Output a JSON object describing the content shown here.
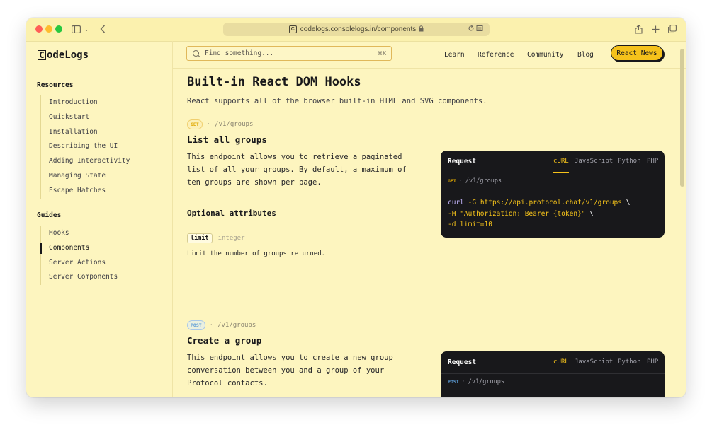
{
  "browser": {
    "url": "codelogs.consolelogs.in/components",
    "site_icon": "C",
    "colors": {
      "close": "#ff5f57",
      "minimize": "#febc2e",
      "maximize": "#28c840"
    }
  },
  "brand": {
    "logo_mark": "C",
    "logo_text": "odeLogs"
  },
  "sidebar": {
    "sections": [
      {
        "heading": "Resources",
        "items": [
          "Introduction",
          "Quickstart",
          "Installation",
          "Describing the UI",
          "Adding Interactivity",
          "Managing State",
          "Escape Hatches"
        ]
      },
      {
        "heading": "Guides",
        "items": [
          "Hooks",
          "Components",
          "Server Actions",
          "Server Components"
        ],
        "active": "Components"
      }
    ]
  },
  "topnav": {
    "search_placeholder": "Find something...",
    "search_shortcut": "⌘K",
    "links": [
      "Learn",
      "Reference",
      "Community",
      "Blog"
    ],
    "cta": "React News"
  },
  "page": {
    "title": "Built-in React DOM Hooks",
    "lead": "React supports all of the browser built-in HTML and SVG components."
  },
  "endpoints": [
    {
      "method": "GET",
      "path": "/v1/groups",
      "title": "List all groups",
      "description": "This endpoint allows you to retrieve a paginated list of all your groups. By default, a maximum of ten groups are shown per page.",
      "optional_heading": "Optional attributes",
      "attribute": {
        "name": "limit",
        "type": "integer",
        "description": "Limit the number of groups returned."
      },
      "request": {
        "title": "Request",
        "tabs": [
          "cURL",
          "JavaScript",
          "Python",
          "PHP"
        ],
        "active_tab": "cURL",
        "code": {
          "line1": {
            "cmd": "curl",
            "flag": "-G",
            "url": "https://api.protocol.chat/v1/groups",
            "cont": "\\"
          },
          "line2": {
            "flag": "-H",
            "value": "\"Authorization: Bearer {token}\"",
            "cont": "\\"
          },
          "line3": {
            "flag": "-d",
            "value": "limit=10"
          }
        }
      }
    },
    {
      "method": "POST",
      "path": "/v1/groups",
      "title": "Create a group",
      "description": "This endpoint allows you to create a new group conversation between you and a group of your Protocol contacts.",
      "request": {
        "title": "Request",
        "tabs": [
          "cURL",
          "JavaScript",
          "Python",
          "PHP"
        ],
        "active_tab": "cURL"
      }
    }
  ]
}
